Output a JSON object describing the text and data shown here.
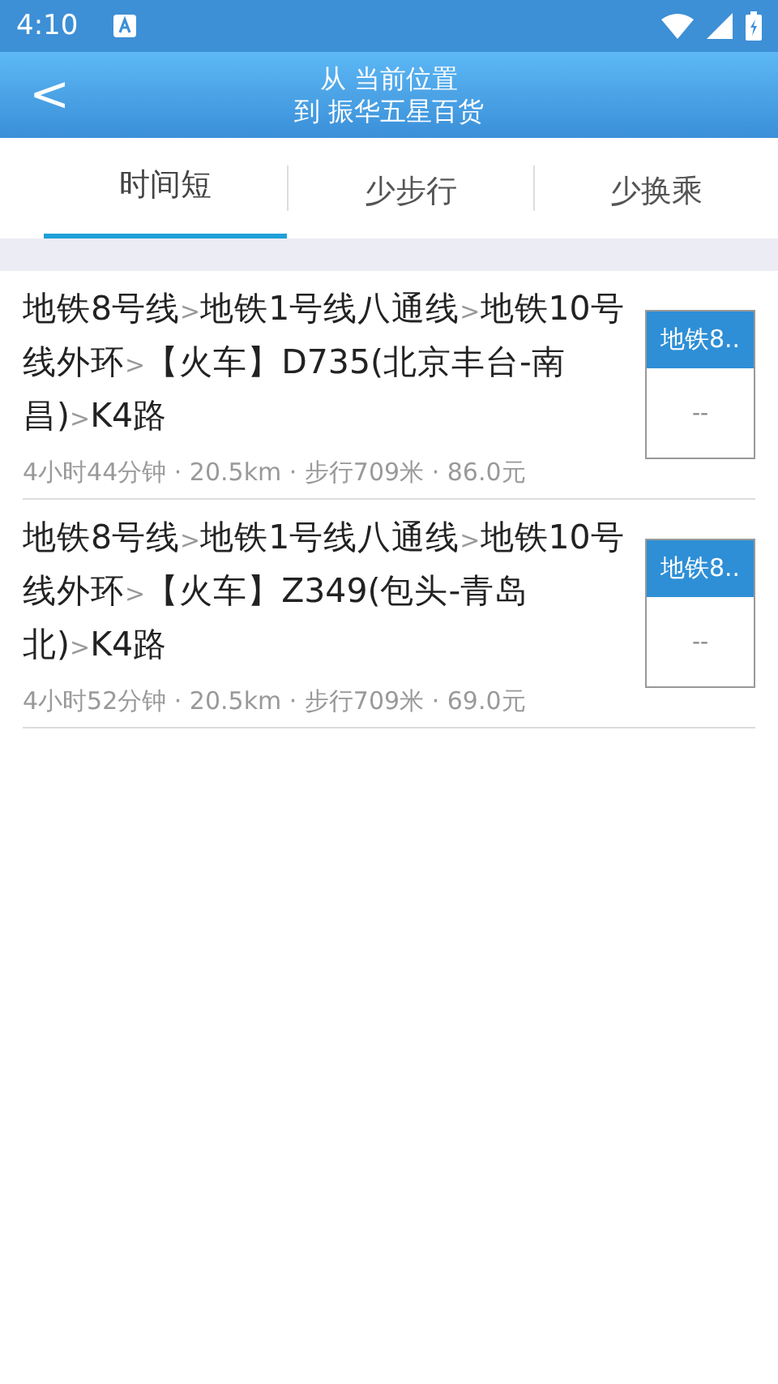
{
  "status_bar": {
    "time": "4:10"
  },
  "header": {
    "back": "<",
    "line1": "从 当前位置",
    "line2": "到 振华五星百货"
  },
  "tabs": [
    {
      "label": "时间短",
      "selected": true
    },
    {
      "label": "少步行",
      "selected": false
    },
    {
      "label": "少换乘",
      "selected": false
    }
  ],
  "routes": [
    {
      "parts": [
        {
          "kind": "seg",
          "text": "地铁8号线"
        },
        {
          "kind": "sep",
          "text": ">"
        },
        {
          "kind": "seg",
          "text": "地铁1号线八通线"
        },
        {
          "kind": "sep",
          "text": ">"
        },
        {
          "kind": "seg",
          "text": "地铁10号线外环"
        },
        {
          "kind": "sep",
          "text": ">"
        },
        {
          "kind": "seg",
          "text": "【火车】D735(北京丰台-南昌)"
        },
        {
          "kind": "sep",
          "text": ">"
        },
        {
          "kind": "seg",
          "text": "K4路"
        }
      ],
      "summary": "4小时44分钟 · 20.5km · 步行709米 · 86.0元",
      "badge": "地铁8..",
      "badge_value": "--"
    },
    {
      "parts": [
        {
          "kind": "seg",
          "text": "地铁8号线"
        },
        {
          "kind": "sep",
          "text": ">"
        },
        {
          "kind": "seg",
          "text": "地铁1号线八通线"
        },
        {
          "kind": "sep",
          "text": ">"
        },
        {
          "kind": "seg",
          "text": "地铁10号线外环"
        },
        {
          "kind": "sep",
          "text": ">"
        },
        {
          "kind": "seg",
          "text": "【火车】Z349(包头-青岛北)"
        },
        {
          "kind": "sep",
          "text": ">"
        },
        {
          "kind": "seg",
          "text": "K4路"
        }
      ],
      "summary": "4小时52分钟 · 20.5km · 步行709米 · 69.0元",
      "badge": "地铁8..",
      "badge_value": "--"
    }
  ]
}
